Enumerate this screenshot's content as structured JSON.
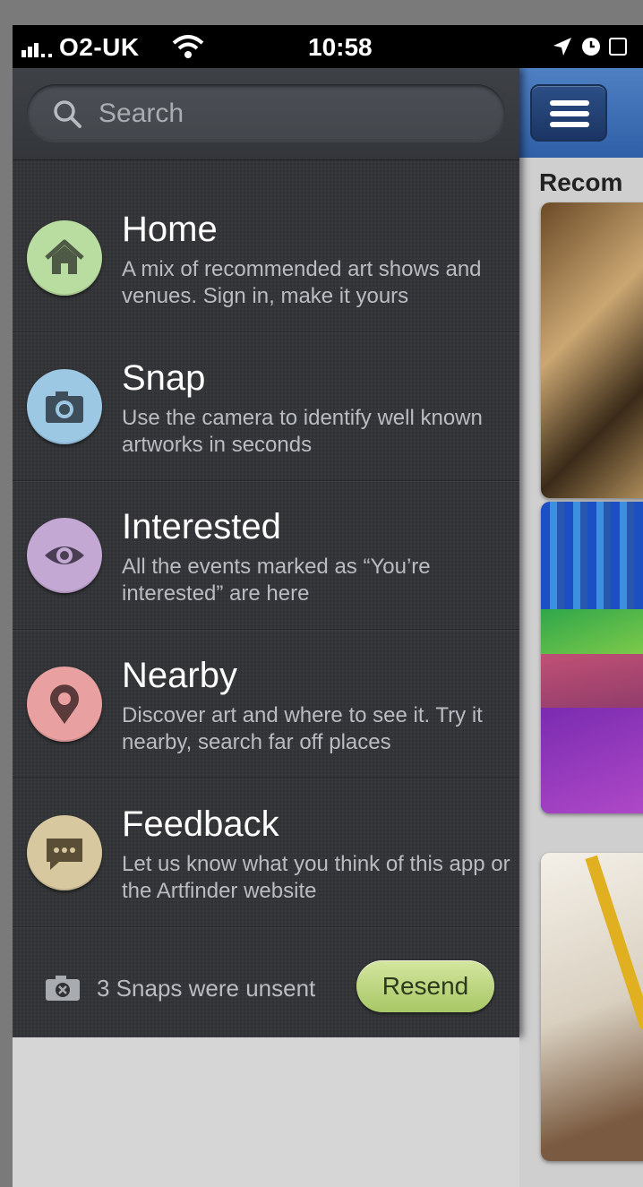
{
  "status_bar": {
    "carrier": "O2-UK",
    "time": "10:58"
  },
  "search": {
    "placeholder": "Search"
  },
  "menu": {
    "items": [
      {
        "title": "Home",
        "description": "A mix of recommended art shows and venues. Sign in, make it yours",
        "icon": "home-icon",
        "color": "#b9dca0"
      },
      {
        "title": "Snap",
        "description": "Use the camera to identify well known artworks in seconds",
        "icon": "camera-icon",
        "color": "#9cc8e4"
      },
      {
        "title": "Interested",
        "description": "All the events marked as “You’re interested” are here",
        "icon": "eye-icon",
        "color": "#c4a8d4"
      },
      {
        "title": "Nearby",
        "description": "Discover art and where to see it. Try it nearby, search far off places",
        "icon": "location-pin-icon",
        "color": "#e8a0a0"
      },
      {
        "title": "Feedback",
        "description": "Let us know what you think of this app or the Artfinder website",
        "icon": "speech-bubble-icon",
        "color": "#d8c8a0"
      }
    ]
  },
  "unsent": {
    "text": "3 Snaps were unsent",
    "button_label": "Resend",
    "button_color": "#b8d47c"
  },
  "content": {
    "section_label": "Recom"
  },
  "colors": {
    "sidebar_bg": "#2f3134",
    "navbar_blue": "#3f6fb5"
  }
}
